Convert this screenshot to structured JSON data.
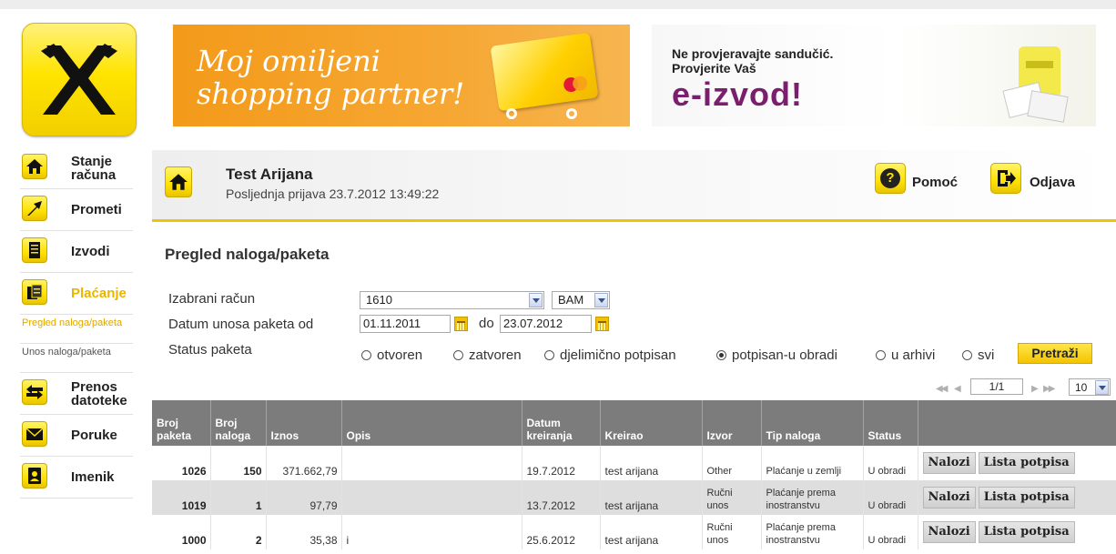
{
  "banners": {
    "shopping": {
      "line1": "Moj omiljeni",
      "line2": "shopping partner!"
    },
    "izvod": {
      "line1": "Ne provjeravajte sandučić.",
      "line2": "Provjerite Vaš",
      "highlight": "e-izvod!"
    }
  },
  "sidebar": {
    "items": [
      {
        "label": "Stanje računa",
        "icon": "home-icon"
      },
      {
        "label": "Prometi",
        "icon": "trend-arrow-icon"
      },
      {
        "label": "Izvodi",
        "icon": "document-icon"
      },
      {
        "label": "Plaćanje",
        "icon": "payment-icon",
        "active": true
      },
      {
        "label": "Prenos datoteke",
        "icon": "transfer-arrows-icon"
      },
      {
        "label": "Poruke",
        "icon": "envelope-icon"
      },
      {
        "label": "Imenik",
        "icon": "address-book-icon"
      }
    ],
    "subitems": [
      {
        "label": "Pregled naloga/paketa",
        "active": true
      },
      {
        "label": "Unos naloga/paketa"
      }
    ]
  },
  "header": {
    "user": "Test Arijana",
    "last_login": "Posljednja prijava 23.7.2012 13:49:22",
    "help_label": "Pomoć",
    "logout_label": "Odjava"
  },
  "page": {
    "title": "Pregled naloga/paketa"
  },
  "filters": {
    "account_label": "Izabrani račun",
    "account_value": "1610",
    "currency_value": "BAM",
    "date_label": "Datum unosa paketa od",
    "date_from": "01.11.2011",
    "date_to_label": "do",
    "date_to": "23.07.2012",
    "status_label": "Status paketa",
    "status_options": [
      "otvoren",
      "zatvoren",
      "djelimično potpisan",
      "potpisan-u obradi",
      "u arhivi",
      "svi"
    ],
    "status_selected": "potpisan-u obradi",
    "search_label": "Pretraži"
  },
  "pager": {
    "page": "1/1",
    "page_size": "10"
  },
  "table": {
    "headers": [
      "Broj paketa",
      "Broj naloga",
      "Iznos",
      "Opis",
      "Datum kreiranja",
      "Kreirao",
      "Izvor",
      "Tip naloga",
      "Status",
      ""
    ],
    "rows": [
      {
        "paket": "1026",
        "nalozi": "150",
        "iznos": "371.662,79",
        "opis": "",
        "datum": "19.7.2012",
        "kreirao": "test arijana",
        "izvor": "Other",
        "tip": "Plaćanje u zemlji",
        "status": "U obradi"
      },
      {
        "paket": "1019",
        "nalozi": "1",
        "iznos": "97,79",
        "opis": "",
        "datum": "13.7.2012",
        "kreirao": "test arijana",
        "izvor": "Ručni unos",
        "tip": "Plaćanje prema inostranstvu",
        "status": "U obradi"
      },
      {
        "paket": "1000",
        "nalozi": "2",
        "iznos": "35,38",
        "opis": "i",
        "datum": "25.6.2012",
        "kreirao": "test arijana",
        "izvor": "Ručni unos",
        "tip": "Plaćanje prema inostranstvu",
        "status": "U obradi"
      }
    ],
    "row_actions": {
      "orders": "Nalozi",
      "signatures": "Lista potpisa"
    }
  }
}
